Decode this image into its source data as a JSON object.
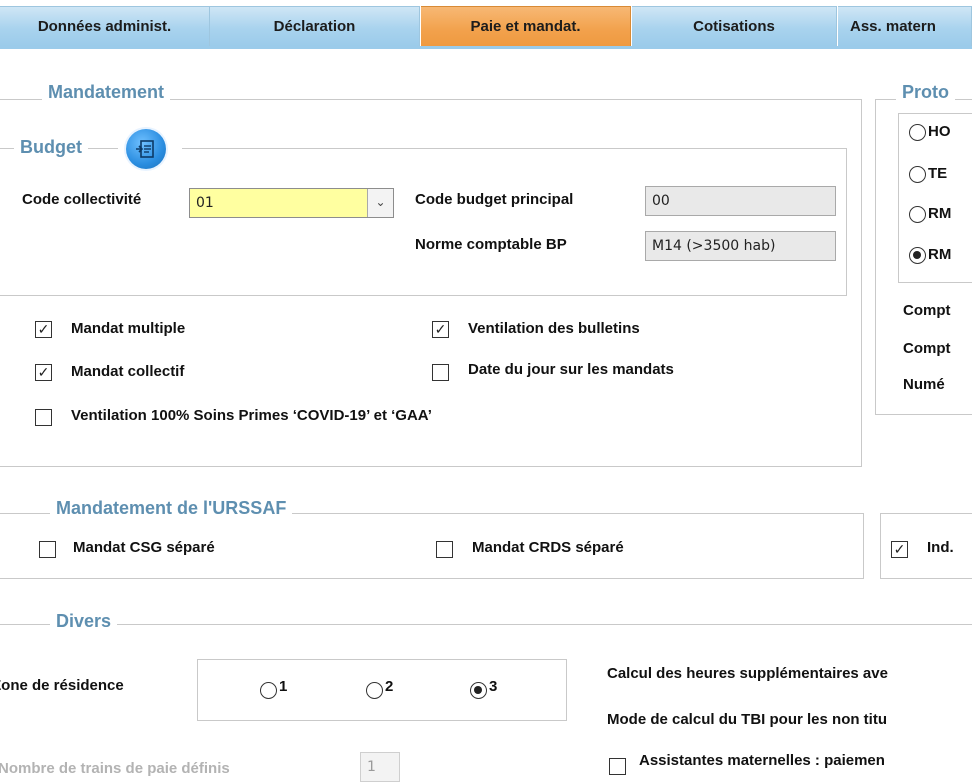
{
  "tabs": [
    {
      "label": "Données administ.",
      "active": false
    },
    {
      "label": "Déclaration",
      "active": false
    },
    {
      "label": "Paie et mandat.",
      "active": true
    },
    {
      "label": "Cotisations",
      "active": false
    },
    {
      "label": "Ass. matern",
      "active": false
    }
  ],
  "mandatement": {
    "legend": "Mandatement",
    "budget": {
      "legend": "Budget",
      "icon": "budget-export-icon",
      "code_collectivite_label": "Code collectivité",
      "code_collectivite_value": "01",
      "code_budget_principal_label": "Code budget principal",
      "code_budget_principal_value": "00",
      "norme_comptable_label": "Norme comptable BP",
      "norme_comptable_value": "M14 (>3500 hab)"
    },
    "checkboxes": {
      "mandat_multiple": {
        "label": "Mandat multiple",
        "checked": true
      },
      "ventilation_bulletins": {
        "label": "Ventilation des bulletins",
        "checked": true
      },
      "mandat_collectif": {
        "label": "Mandat collectif",
        "checked": true
      },
      "date_du_jour": {
        "label": "Date du jour sur les mandats",
        "checked": false
      },
      "ventilation_covid": {
        "label": "Ventilation 100% Soins Primes ‘COVID-19’ et ‘GAA’",
        "checked": false
      }
    }
  },
  "protocole": {
    "legend": "Proto",
    "options": [
      {
        "label": "HO",
        "selected": false
      },
      {
        "label": "TE",
        "selected": false
      },
      {
        "label": "RM",
        "selected": false
      },
      {
        "label": "RM",
        "selected": true
      }
    ],
    "labels": [
      "Compt",
      "Compt",
      "Numé"
    ]
  },
  "urssaf": {
    "legend": "Mandatement de l'URSSAF",
    "mandat_csg": {
      "label": "Mandat CSG séparé",
      "checked": false
    },
    "mandat_crds": {
      "label": "Mandat CRDS séparé",
      "checked": false
    },
    "ind": {
      "label": "Ind.",
      "checked": true
    }
  },
  "divers": {
    "legend": "Divers",
    "zone_label": "Zone de résidence",
    "zone_options": [
      {
        "label": "1",
        "selected": false
      },
      {
        "label": "2",
        "selected": false
      },
      {
        "label": "3",
        "selected": true
      }
    ],
    "trains_label": "Nombre de trains de paie définis",
    "trains_value": "1",
    "heures_sup_label": "Calcul des heures supplémentaires ave",
    "tbi_label": "Mode de calcul du TBI pour les non titu",
    "assistantes": {
      "label": "Assistantes maternelles : paiemen",
      "checked": false
    }
  }
}
